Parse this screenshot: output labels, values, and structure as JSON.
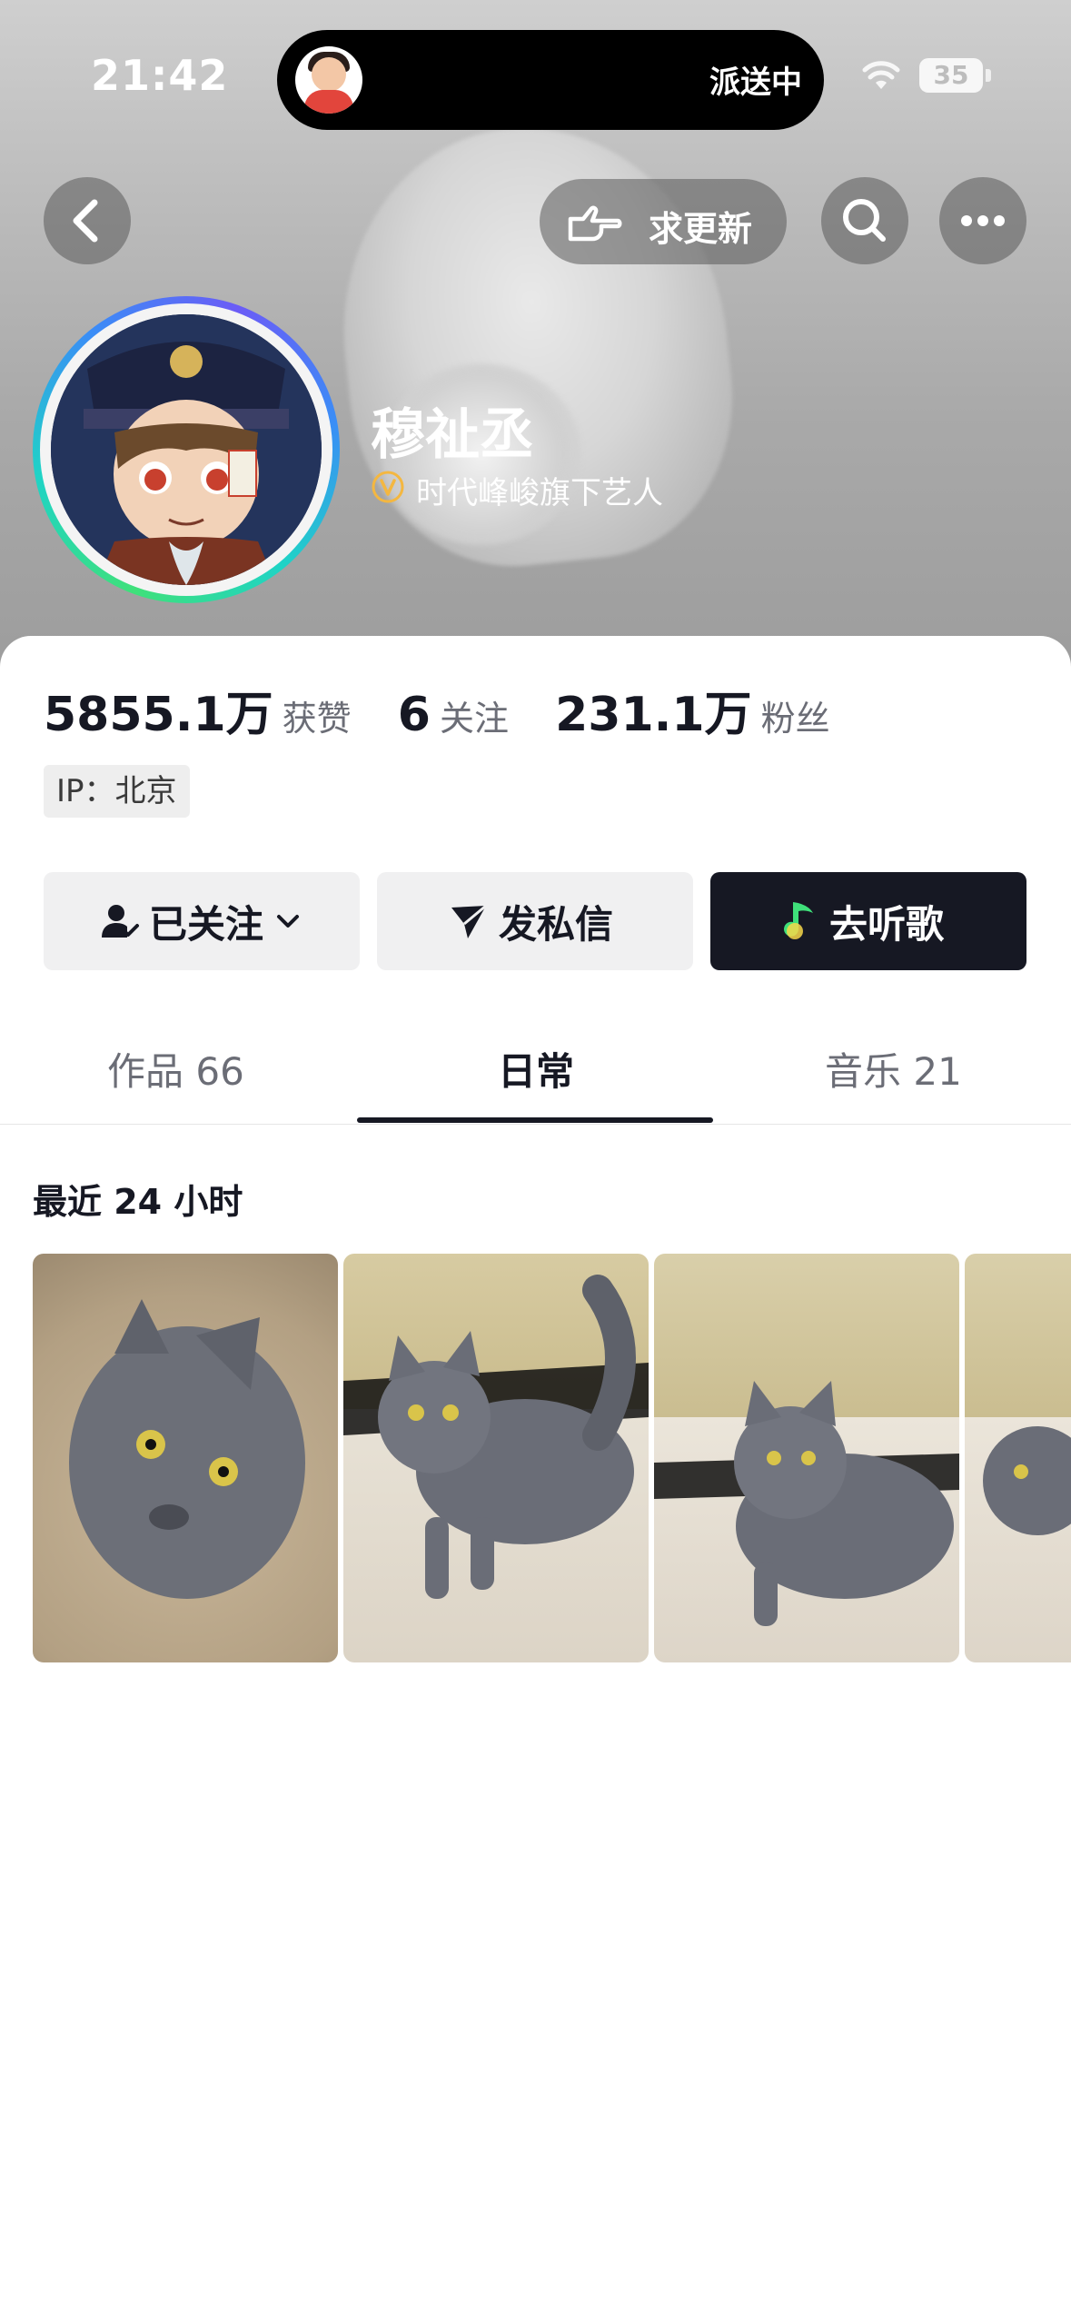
{
  "status_bar": {
    "time": "21:42",
    "island_text": "派送中",
    "battery": "35"
  },
  "header": {
    "update_label": "求更新"
  },
  "profile": {
    "name": "穆祉丞",
    "verification": "时代峰峻旗下艺人"
  },
  "stats": [
    {
      "value": "5855.1万",
      "label": "获赞"
    },
    {
      "value": "6",
      "label": "关注"
    },
    {
      "value": "231.1万",
      "label": "粉丝"
    }
  ],
  "ip_label": "IP：北京",
  "actions": {
    "follow": "已关注",
    "message": "发私信",
    "listen": "去听歌"
  },
  "tabs": [
    {
      "label": "作品 66"
    },
    {
      "label": "日常"
    },
    {
      "label": "音乐 21"
    }
  ],
  "active_tab": "日常",
  "section": {
    "title": "最近 24 小时"
  },
  "colors": {
    "primary_dark": "#161823",
    "secondary_text": "#6b6d76",
    "button_gray": "#f0f0f1",
    "music_green": "#3fe07a"
  }
}
